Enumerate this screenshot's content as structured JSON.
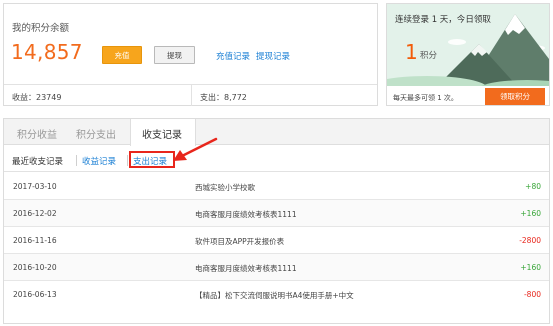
{
  "balance": {
    "title": "我的积分余额",
    "amount": "14,857",
    "recharge_button": "充值",
    "withdraw_button": "提现",
    "recharge_records_link": "充值记录",
    "withdraw_records_link": "提现记录",
    "income_label": "收益：23749",
    "expense_label": "支出：8,772"
  },
  "bonus": {
    "headline": "连续登录 1 天，今日领取",
    "points_number": "1",
    "points_unit": "积分",
    "daily_note": "每天最多可领 1 次。",
    "claim_button": "领取积分"
  },
  "tabs": [
    {
      "label": "积分收益",
      "active": false
    },
    {
      "label": "积分支出",
      "active": false
    },
    {
      "label": "收支记录",
      "active": true
    }
  ],
  "subnav": {
    "recent": "最近收支记录",
    "income": "收益记录",
    "expense": "支出记录"
  },
  "records": [
    {
      "date": "2017-03-10",
      "desc": "西城实验小学校歌",
      "amount": "+80",
      "type": "pos"
    },
    {
      "date": "2016-12-02",
      "desc": "电商客服月度绩效考核表1111",
      "amount": "+160",
      "type": "pos"
    },
    {
      "date": "2016-11-16",
      "desc": "软件项目及APP开发报价表",
      "amount": "-2800",
      "type": "neg"
    },
    {
      "date": "2016-10-20",
      "desc": "电商客服月度绩效考核表1111",
      "amount": "+160",
      "type": "pos"
    },
    {
      "date": "2016-06-13",
      "desc": "【精品】松下交流伺服说明书A4使用手册+中文",
      "amount": "-800",
      "type": "neg"
    }
  ],
  "colors": {
    "accent_orange": "#f26b1d",
    "button_yellow": "#f7a51c",
    "link_blue": "#1a7fd4",
    "positive_green": "#37a537",
    "negative_red": "#e8261c",
    "highlight_red": "#e8261c"
  }
}
